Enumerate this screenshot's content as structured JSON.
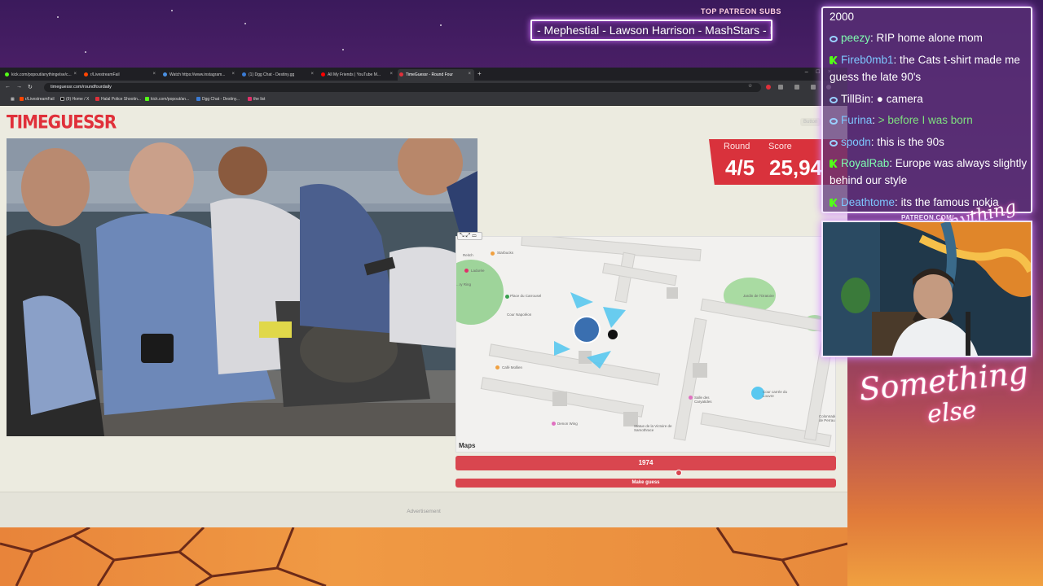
{
  "overlay": {
    "patreon_title": "TOP PATREON SUBS",
    "patreon_names": "- Mephestial - Lawson Harrison - MashStars - I",
    "patreon_tag": "PATREON.COM/",
    "signature_small": "Anything else",
    "signature_large_top": "Something",
    "signature_large_bottom": "else"
  },
  "browser": {
    "tabs": [
      {
        "label": "kick.com/popout/anythingelse/c..."
      },
      {
        "label": "r/LivestreamFail"
      },
      {
        "label": "Watch https://www.instagram..."
      },
      {
        "label": "(1) Dgg Chat - Destiny.gg"
      },
      {
        "label": "All My Friends | YouTube M..."
      },
      {
        "label": "TimeGuessr - Round Four"
      }
    ],
    "url": "timeguessr.com/roundfourdaily",
    "bookmarks": [
      {
        "label": "r/LivestreamFail"
      },
      {
        "label": "(9) Home / X"
      },
      {
        "label": "Halal Police Shootin..."
      },
      {
        "label": "kick.com/popout/an..."
      },
      {
        "label": "Dgg Chat - Destiny..."
      },
      {
        "label": "the list"
      }
    ]
  },
  "page": {
    "logo": "TIMEGUESSR",
    "login": "Button",
    "round_label": "Round",
    "round_value": "4/5",
    "score_label": "Score",
    "score_value": "25,94",
    "year_value": "1974",
    "make_guess": "Make guess",
    "advertisement": "Advertisement",
    "maps_logo": "Maps",
    "map_labels": {
      "starbucks": "Starbucks",
      "laduree": "Ladurée",
      "place_carrousel": "Place du Carrousel",
      "cour_napoleon": "Cour Napoléon",
      "cafe_mollien": "Café Mollien",
      "jardin_oratoire": "Jardin de l'Oratoire",
      "salle_caryatides": "Salle des Caryatides",
      "cour_carree": "Cour carrée du Louvre",
      "denon_wing": "Denon Wing",
      "statue_victoire": "Statue de la Victoire de Samothrace",
      "colonnade": "Colonnade de Perrault",
      "reitch": "Reitch",
      "tuileries": "...ry Ring"
    }
  },
  "chat": {
    "top_number": "2000",
    "messages": [
      {
        "user": "peezy",
        "text": "RIP home alone mom",
        "color": "#7fffb0",
        "badge": "loop"
      },
      {
        "user": "Fireb0mb1",
        "text": "the Cats t-shirt made me guess the late 90's",
        "color": "#7ec8ff",
        "badge": "kick"
      },
      {
        "user": "TillBin",
        "text": "camera",
        "color": "#ffffff",
        "badge": "loop"
      },
      {
        "user": "Furina",
        "text": "> before I was born",
        "color": "#7ec8ff",
        "badge": "loop",
        "text_color": "#7fe07f"
      },
      {
        "user": "spodn",
        "text": "this is the 90s",
        "color": "#7ec8ff",
        "badge": "loop"
      },
      {
        "user": "RoyalRab",
        "text": "Europe was always slightly behind our style",
        "color": "#7fffb0",
        "badge": "kick"
      },
      {
        "user": "Deathtome",
        "text": "its the famous nokia",
        "color": "#7ec8ff",
        "badge": "kick"
      }
    ]
  },
  "colors": {
    "accent": "#d9323c",
    "chat_border": "#f2e6ff"
  }
}
